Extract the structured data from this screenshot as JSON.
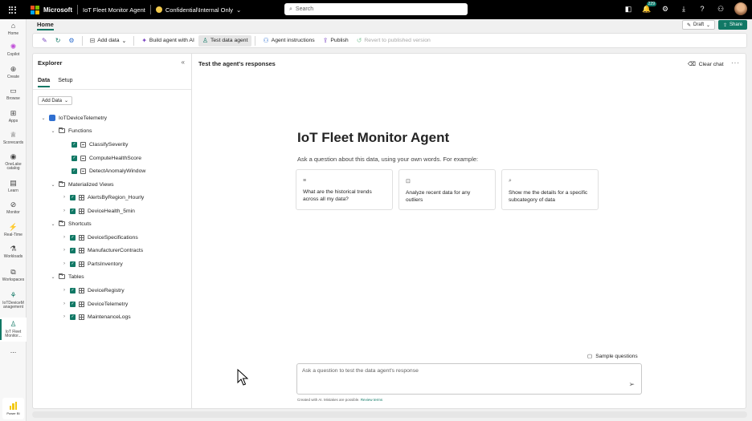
{
  "topbar": {
    "brand": "Microsoft",
    "workspace_title": "IoT Fleet Monitor Agent",
    "sensitivity_label": "Confidential\\Internal Only",
    "search_placeholder": "Search",
    "notification_count": "229"
  },
  "rail": {
    "items": [
      {
        "label": "Home",
        "icon": "home-icon"
      },
      {
        "label": "Copilot",
        "icon": "copilot-icon"
      },
      {
        "label": "Create",
        "icon": "create-icon"
      },
      {
        "label": "Browse",
        "icon": "browse-icon"
      },
      {
        "label": "Apps",
        "icon": "apps-icon"
      },
      {
        "label": "Scorecards",
        "icon": "trophy-icon"
      },
      {
        "label": "OneLake catalog",
        "icon": "onelake-icon"
      },
      {
        "label": "Learn",
        "icon": "book-icon"
      },
      {
        "label": "Monitor",
        "icon": "monitor-icon"
      },
      {
        "label": "Real-Time",
        "icon": "realtime-icon"
      },
      {
        "label": "Workloads",
        "icon": "workloads-icon"
      },
      {
        "label": "Workspaces",
        "icon": "workspaces-icon"
      },
      {
        "label": "IoTDeviceM anagement",
        "icon": "workspace-icon"
      },
      {
        "label": "IoT Fleet Monitor...",
        "icon": "agent-icon"
      }
    ],
    "more": "...",
    "powerbi_label": "Power BI"
  },
  "header": {
    "home_tab": "Home",
    "draft_label": "Draft",
    "share_label": "Share"
  },
  "toolbar": {
    "add_data": "Add data",
    "build_agent": "Build agent with AI",
    "test_agent": "Test data agent",
    "agent_instructions": "Agent instructions",
    "publish": "Publish",
    "revert": "Revert to published version"
  },
  "explorer": {
    "title": "Explorer",
    "tabs": [
      "Data",
      "Setup"
    ],
    "add_data_btn": "Add Data",
    "database": "IoTDeviceTelemetry",
    "groups": [
      {
        "name": "Functions",
        "items": [
          "ClassifySeverity",
          "ComputeHealthScore",
          "DetectAnomalyWindow"
        ]
      },
      {
        "name": "Materialized Views",
        "items": [
          "AlertsByRegion_Hourly",
          "DeviceHealth_5min"
        ]
      },
      {
        "name": "Shortcuts",
        "items": [
          "DeviceSpecifications",
          "ManufacturerContracts",
          "PartsInventory"
        ]
      },
      {
        "name": "Tables",
        "items": [
          "DeviceRegistry",
          "DeviceTelemetry",
          "MaintenanceLogs"
        ]
      }
    ]
  },
  "panel": {
    "title": "Test the agent's responses",
    "clear_chat": "Clear chat",
    "agent_name": "IoT Fleet Monitor Agent",
    "subtitle": "Ask a question about this data, using your own words. For example:",
    "suggestions": [
      "What are the historical trends across all my data?",
      "Analyze recent data for any outliers",
      "Show me the details for a specific subcategory of data"
    ],
    "sample_questions": "Sample questions",
    "input_placeholder": "Ask a question to test the data agent's response",
    "footnote": "Created with AI. Mistakes are possible.",
    "footnote_link": "Review terms"
  },
  "colors": {
    "accent": "#117865",
    "topbar": "#000000"
  }
}
